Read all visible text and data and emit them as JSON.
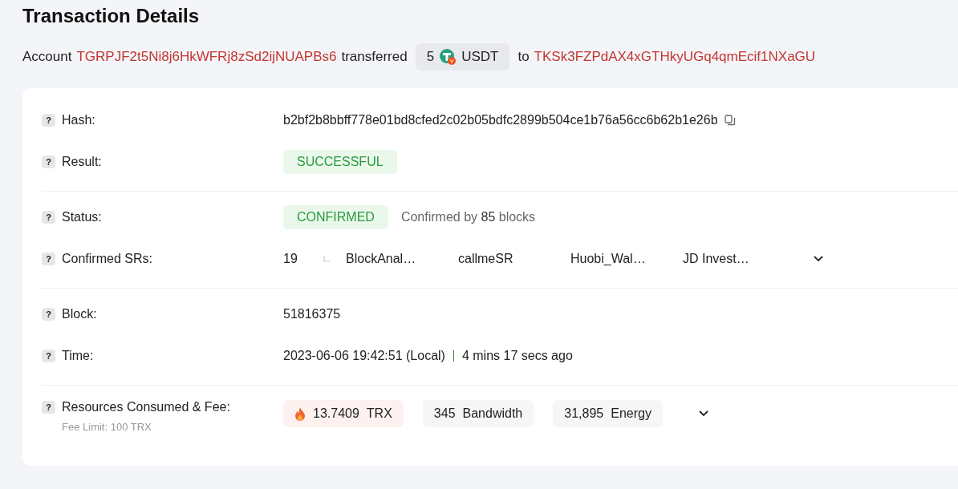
{
  "title": "Transaction Details",
  "summary": {
    "prefix": "Account",
    "from": "TGRPJF2t5Ni8j6HkWFRj8zSd2ijNUAPBs6",
    "verb": "transferred",
    "amount": "5",
    "token": "USDT",
    "joiner": "to",
    "to": "TKSk3FZPdAX4xGTHkyUGq4qmEcif1NXaGU"
  },
  "sections": [
    [
      {
        "kind": "hash",
        "help": "?",
        "label": "Hash:",
        "value": "b2bf2b8bbff778e01bd8cfed2c02b05bdfc2899b504ce1b76a56cc6b62b1e26b"
      },
      {
        "kind": "badge",
        "help": "?",
        "label": "Result:",
        "value": "SUCCESSFUL"
      }
    ],
    [
      {
        "kind": "status",
        "help": "?",
        "label": "Status:",
        "value": "CONFIRMED",
        "note": "Confirmed by",
        "count": "85",
        "unit": "blocks"
      },
      {
        "kind": "srs",
        "help": "?",
        "label": "Confirmed SRs:",
        "count": "19",
        "names": [
          "BlockAnal…",
          "callmeSR",
          "Huobi_Wal…",
          "JD Invest…"
        ],
        "expanded": false
      }
    ],
    [
      {
        "kind": "text",
        "help": "?",
        "label": "Block:",
        "value": "51816375"
      },
      {
        "kind": "time",
        "help": "?",
        "label": "Time:",
        "value": "2023-06-06 19:42:51 (Local)",
        "ago": "4 mins 17 secs ago"
      }
    ],
    [
      {
        "kind": "fee",
        "help": "?",
        "label": "Resources Consumed & Fee:",
        "sublabel": "Fee Limit: 100 TRX",
        "fee": "13.7409",
        "fee_unit": "TRX",
        "bandwidth": "345",
        "bandwidth_unit": "Bandwidth",
        "energy": "31,895",
        "energy_unit": "Energy",
        "expanded": false
      }
    ]
  ]
}
